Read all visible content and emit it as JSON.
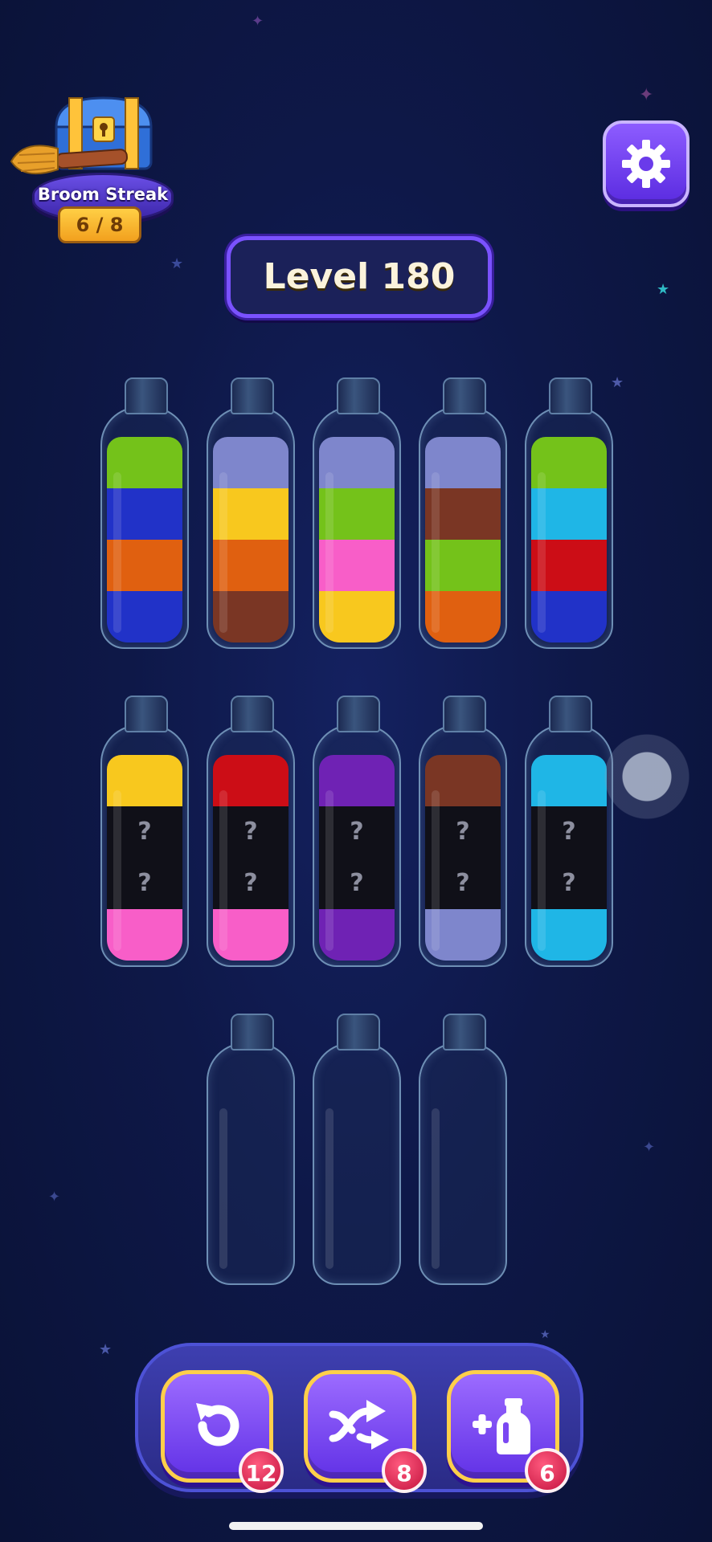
{
  "streak": {
    "label": "Broom Streak",
    "progress": "6 / 8"
  },
  "level": {
    "title": "Level 180"
  },
  "colors": {
    "green": "#74c21a",
    "blue": "#2132c8",
    "orange": "#e06010",
    "lavender": "#7e86cc",
    "yellow": "#f8c81e",
    "brown": "#7a3624",
    "pink": "#f85ec8",
    "cyan": "#1fb6e6",
    "red": "#cc0d16",
    "purple": "#6f22b4",
    "hidden": "#101018"
  },
  "bottles": [
    {
      "layers": [
        "blue",
        "orange",
        "blue",
        "green"
      ]
    },
    {
      "layers": [
        "brown",
        "orange",
        "yellow",
        "lavender"
      ]
    },
    {
      "layers": [
        "yellow",
        "pink",
        "green",
        "lavender"
      ]
    },
    {
      "layers": [
        "orange",
        "green",
        "brown",
        "lavender"
      ]
    },
    {
      "layers": [
        "blue",
        "red",
        "cyan",
        "green"
      ]
    },
    {
      "layers": [
        "pink",
        "hidden",
        "hidden",
        "yellow"
      ]
    },
    {
      "layers": [
        "pink",
        "hidden",
        "hidden",
        "red"
      ]
    },
    {
      "layers": [
        "purple",
        "hidden",
        "hidden",
        "purple"
      ]
    },
    {
      "layers": [
        "lavender",
        "hidden",
        "hidden",
        "brown"
      ]
    },
    {
      "layers": [
        "cyan",
        "hidden",
        "hidden",
        "cyan"
      ]
    },
    {
      "layers": []
    },
    {
      "layers": []
    },
    {
      "layers": []
    }
  ],
  "hidden_mark": "?",
  "powerups": {
    "undo": {
      "icon": "undo-icon",
      "count": "12"
    },
    "shuffle": {
      "icon": "shuffle-icon",
      "count": "8"
    },
    "add_bottle": {
      "icon": "add-bottle-icon",
      "count": "6"
    }
  }
}
